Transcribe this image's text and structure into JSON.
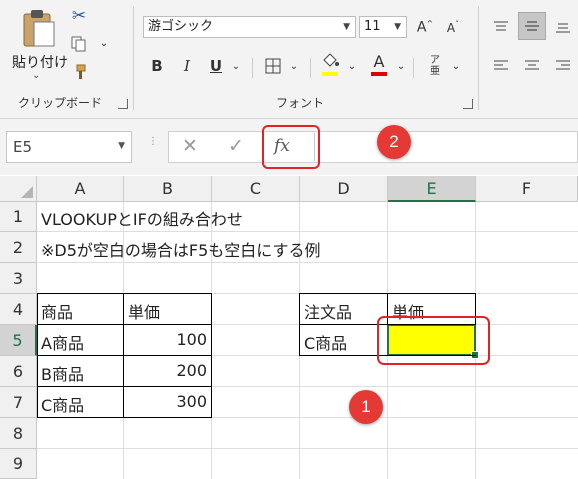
{
  "ribbon": {
    "clipboard": {
      "paste_label": "貼り付け",
      "group_label": "クリップボード"
    },
    "font": {
      "font_name": "游ゴシック",
      "font_size": "11",
      "bold": "B",
      "italic": "I",
      "underline": "U",
      "group_label": "フォント",
      "fill_color": "#ffff00",
      "font_color": "#e00000"
    }
  },
  "formula_bar": {
    "name_box": "E5",
    "cancel": "✕",
    "enter": "✓",
    "fx": "fx",
    "content": ""
  },
  "grid": {
    "columns": [
      "A",
      "B",
      "C",
      "D",
      "E",
      "F"
    ],
    "rows": [
      "1",
      "2",
      "3",
      "4",
      "5",
      "6",
      "7",
      "8",
      "9"
    ],
    "cells": {
      "A1": "VLOOKUPとIFの組み合わせ",
      "A2": "※D5が空白の場合はF5も空白にする例",
      "A4": "商品",
      "B4": "単価",
      "A5": "A商品",
      "B5": "100",
      "A6": "B商品",
      "B6": "200",
      "A7": "C商品",
      "B7": "300",
      "D4": "注文品",
      "E4": "単価",
      "D5": "C商品"
    },
    "selected_cell": "E5",
    "selected_fill": "#ffff00"
  },
  "annotations": {
    "badge1": "1",
    "badge2": "2"
  }
}
